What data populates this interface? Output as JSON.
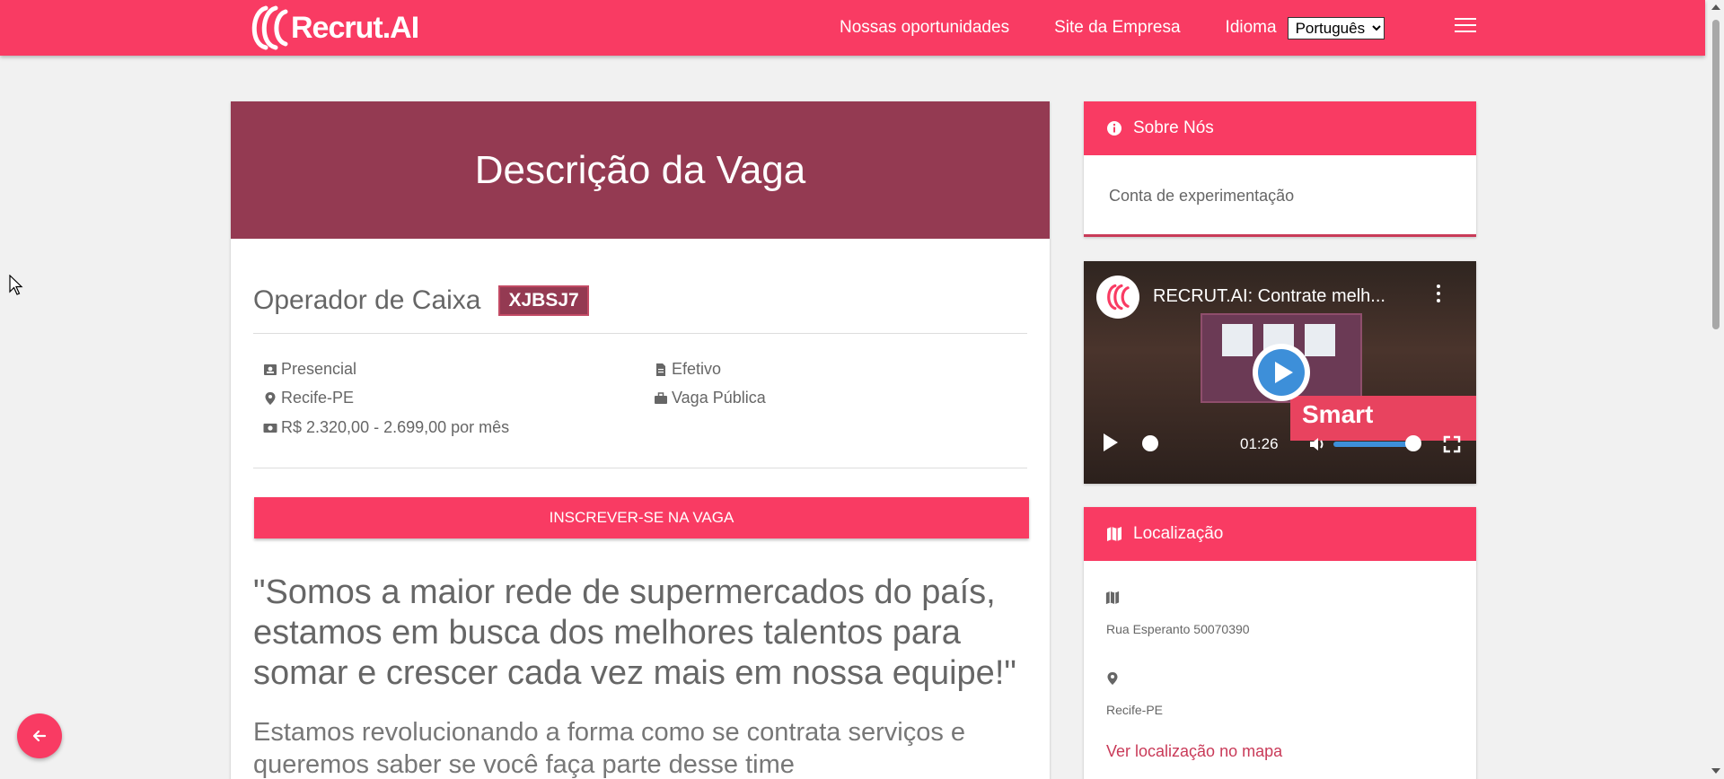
{
  "nav": {
    "logo_text": "Recrut.AI",
    "link_opportunities": "Nossas oportunidades",
    "link_company_site": "Site da Empresa",
    "language_label": "Idioma",
    "language_selected": "Português"
  },
  "job": {
    "header": "Descrição da Vaga",
    "title": "Operador de Caixa",
    "code": "XJBSJ7",
    "work_mode": "Presencial",
    "location": "Recife-PE",
    "salary": "R$ 2.320,00 - 2.699,00 por mês",
    "contract": "Efetivo",
    "visibility": "Vaga Pública",
    "apply_label": "INSCREVER-SE NA VAGA",
    "quote": "\"Somos a maior rede de supermercados do país, estamos em busca dos melhores talentos para somar e crescer cada vez mais em nossa equipe!\"",
    "sub_quote": "Estamos revolucionando a forma como se contrata serviços e queremos saber se você faça parte desse time"
  },
  "about": {
    "title": "Sobre Nós",
    "text": "Conta de experimentação"
  },
  "video": {
    "title": "RECRUT.AI: Contrate melh...",
    "screen_text": "Smart",
    "time": "01:26"
  },
  "location": {
    "title": "Localização",
    "address": "Rua Esperanto 50070390",
    "city": "Recife-PE",
    "map_link": "Ver localização no mapa"
  },
  "colors": {
    "brand": "#f93b63",
    "header_dark": "#943a52"
  }
}
